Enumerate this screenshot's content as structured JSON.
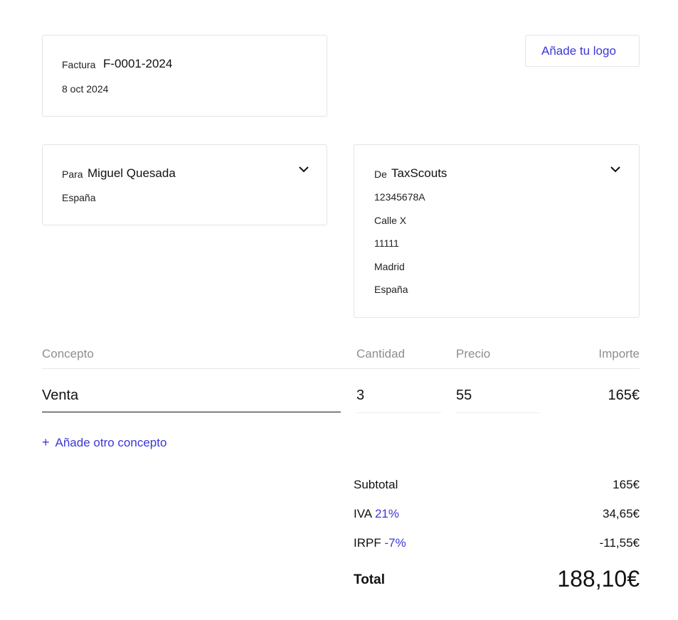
{
  "invoice": {
    "label": "Factura",
    "number": "F-0001-2024",
    "date": "8 oct 2024"
  },
  "logo_button": {
    "label": "Añade tu logo"
  },
  "client": {
    "prefix": "Para",
    "name": "Miguel Quesada",
    "lines": [
      "España"
    ]
  },
  "issuer": {
    "prefix": "De",
    "name": "TaxScouts",
    "lines": [
      "12345678A",
      "Calle X",
      "11111",
      "Madrid",
      "España"
    ]
  },
  "table": {
    "headers": {
      "concept": "Concepto",
      "quantity": "Cantidad",
      "price": "Precio",
      "amount": "Importe"
    },
    "rows": [
      {
        "concept": "Venta",
        "quantity": "3",
        "price": "55",
        "amount": "165€"
      }
    ],
    "add_label": "Añade otro concepto",
    "add_symbol": "+"
  },
  "totals": {
    "subtotal_label": "Subtotal",
    "subtotal_value": "165€",
    "iva_label": "IVA",
    "iva_rate": "21%",
    "iva_value": "34,65€",
    "irpf_label": "IRPF",
    "irpf_rate": "-7%",
    "irpf_value": "-11,55€",
    "total_label": "Total",
    "total_value": "188,10€"
  },
  "icons": {
    "client_toggle": "chevron-down-icon",
    "issuer_toggle": "chevron-down-icon"
  },
  "colors": {
    "accent": "#3b37d6",
    "border": "#e4e4e8",
    "muted": "#8b8b8b"
  }
}
